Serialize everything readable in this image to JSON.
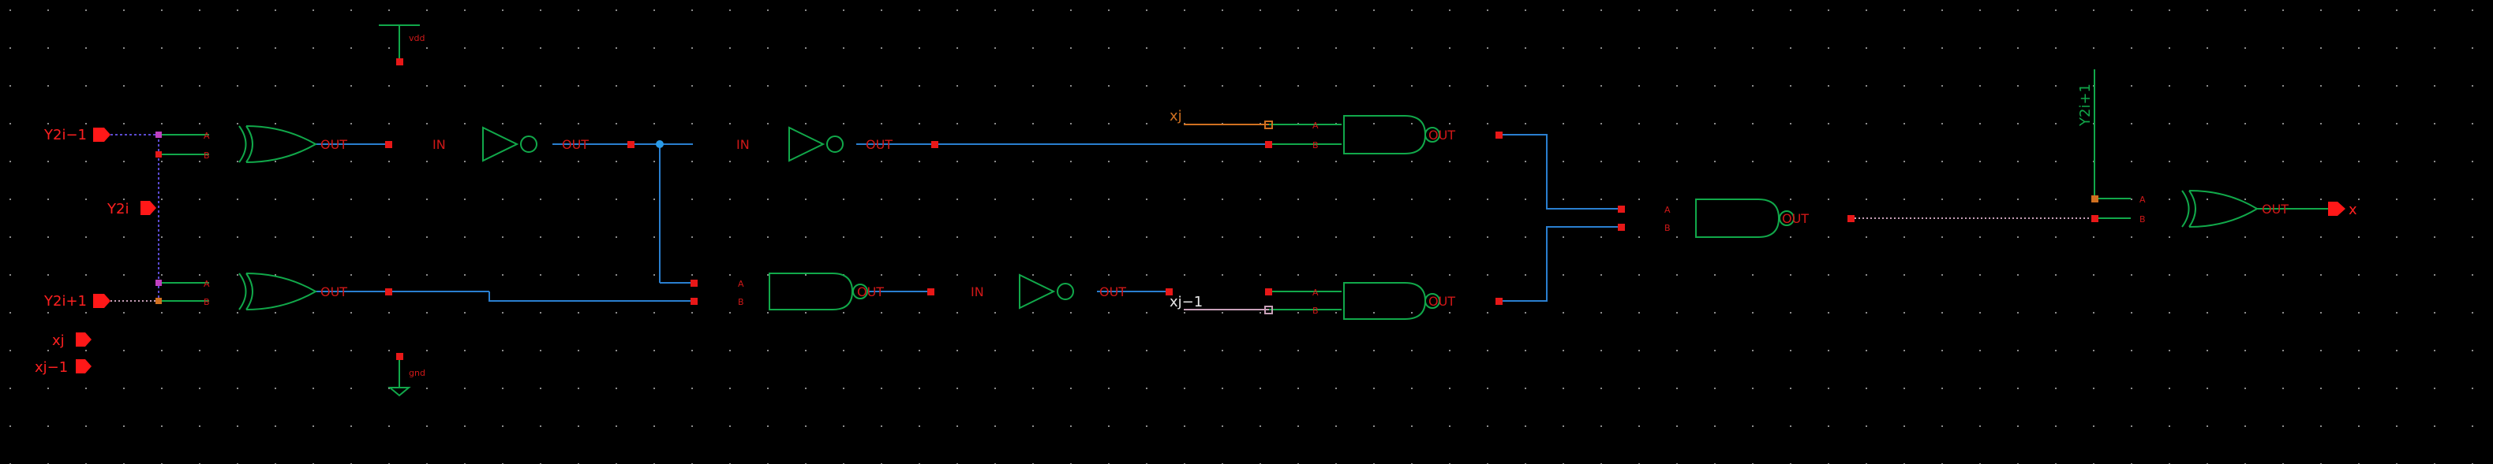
{
  "colors": {
    "background": "#000000",
    "grid_dot": "#8a8a8a",
    "gate": "#11a84a",
    "pin": "#d01818",
    "pin_node": "#e81818",
    "wire_blue": "#2a7fd0",
    "wire_orange": "#d07020",
    "wire_purple": "#5a4ad0",
    "port": "#ff1818",
    "dot_pink": "#c8a0b8"
  },
  "ports": {
    "y2i_minus_1": "Y2i−1",
    "y2i": "Y2i",
    "y2i_plus_1": "Y2i+1",
    "xj": "xj",
    "xj_minus_1": "xj−1",
    "x_out": "x"
  },
  "supplies": {
    "vdd": "vdd",
    "gnd": "gnd"
  },
  "pins": {
    "a": "A",
    "b": "B",
    "out": "OUT",
    "in": "IN"
  },
  "net_labels": {
    "xj": "xj",
    "xj_minus_1": "xj−1",
    "y2i_plus_1_vertical": "Y2i+1"
  }
}
